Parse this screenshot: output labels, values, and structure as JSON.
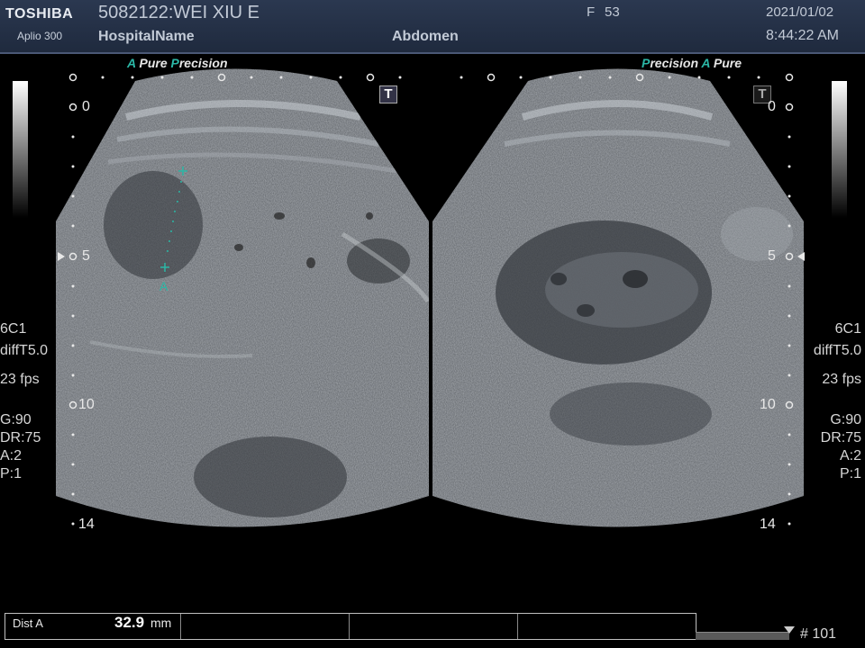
{
  "header": {
    "brand": "TOSHIBA",
    "model": "Aplio 300",
    "patient_id": "5082122:WEI XIU E",
    "hospital": "HospitalName",
    "sex": "F",
    "age": "53",
    "exam": "Abdomen",
    "date": "2021/01/02",
    "time": "8:44:22 AM"
  },
  "left_image": {
    "mode_a": "A",
    "mode_pure": "Pure",
    "mode_p": "P",
    "mode_precision": "recision",
    "t_marker": "T",
    "depth_marks": [
      "0",
      "5",
      "10",
      "14"
    ],
    "caliper_label": "A"
  },
  "right_image": {
    "mode_p": "P",
    "mode_precision": "recision",
    "mode_a": "A",
    "mode_pure": "Pure",
    "t_marker": "T",
    "depth_marks": [
      "0",
      "5",
      "10",
      "14"
    ]
  },
  "params": {
    "probe": "6C1",
    "filter": "diffT5.0",
    "fps": "23 fps",
    "gain": "G:90",
    "dr": "DR:75",
    "a": "A:2",
    "p": "P:1"
  },
  "measurement": {
    "label": "Dist A",
    "value": "32.9",
    "unit": "mm"
  },
  "frame": "# 101",
  "colors": {
    "accent": "#2bb7a6",
    "header_bg": "#24304a"
  }
}
